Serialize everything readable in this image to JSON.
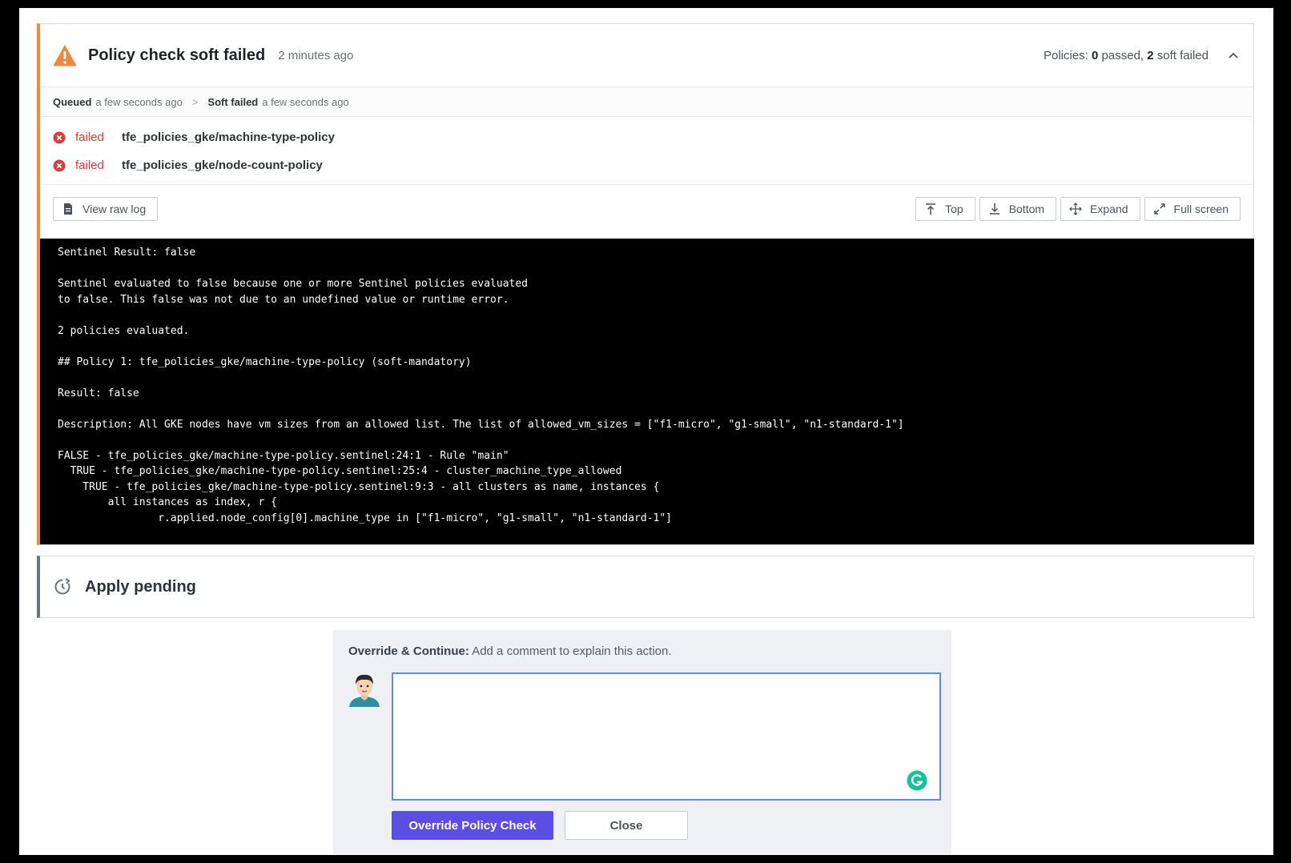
{
  "policy_check": {
    "title": "Policy check soft failed",
    "time": "2 minutes ago",
    "summary": {
      "prefix": "Policies:",
      "passed_count": "0",
      "passed_label": "passed,",
      "soft_failed_count": "2",
      "soft_failed_label": "soft failed"
    },
    "timeline": [
      {
        "status": "Queued",
        "time": "a few seconds ago"
      },
      {
        "status": "Soft failed",
        "time": "a few seconds ago"
      }
    ],
    "timeline_separator": ">",
    "results": [
      {
        "status": "failed",
        "name": "tfe_policies_gke/machine-type-policy"
      },
      {
        "status": "failed",
        "name": "tfe_policies_gke/node-count-policy"
      }
    ],
    "toolbar": {
      "view_raw_log": "View raw log",
      "top": "Top",
      "bottom": "Bottom",
      "expand": "Expand",
      "full_screen": "Full screen"
    },
    "log_text": "Sentinel Result: false\n\nSentinel evaluated to false because one or more Sentinel policies evaluated\nto false. This false was not due to an undefined value or runtime error.\n\n2 policies evaluated.\n\n## Policy 1: tfe_policies_gke/machine-type-policy (soft-mandatory)\n\nResult: false\n\nDescription: All GKE nodes have vm sizes from an allowed list. The list of allowed_vm_sizes = [\"f1-micro\", \"g1-small\", \"n1-standard-1\"]\n\nFALSE - tfe_policies_gke/machine-type-policy.sentinel:24:1 - Rule \"main\"\n  TRUE - tfe_policies_gke/machine-type-policy.sentinel:25:4 - cluster_machine_type_allowed\n    TRUE - tfe_policies_gke/machine-type-policy.sentinel:9:3 - all clusters as name, instances {\n        all instances as index, r {\n                r.applied.node_config[0].machine_type in [\"f1-micro\", \"g1-small\", \"n1-standard-1\"]",
    "accent_color": "#f0883e",
    "fail_color": "#e03a3a"
  },
  "apply": {
    "title": "Apply pending"
  },
  "override": {
    "label_bold": "Override & Continue:",
    "label_rest": "Add a comment to explain this action.",
    "comment_value": "",
    "submit_label": "Override Policy Check",
    "close_label": "Close",
    "primary_color": "#5c4ee5"
  }
}
